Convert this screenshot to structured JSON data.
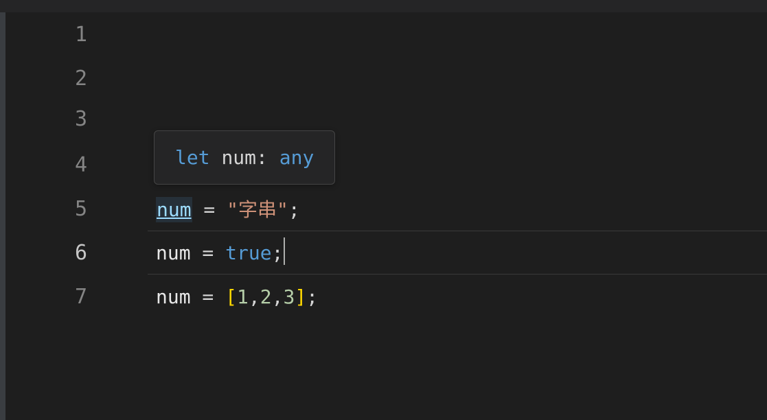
{
  "gutter": {
    "ln1": "1",
    "ln2": "2",
    "ln3": "3",
    "ln4": "4",
    "ln5": "5",
    "ln6": "6",
    "ln7": "7"
  },
  "tooltip": {
    "keyword": "let",
    "identifier": "num",
    "colon": ": ",
    "type": "any"
  },
  "line5": {
    "var": "num",
    "op": " = ",
    "str": "\"字串\"",
    "semi": ";"
  },
  "line6": {
    "var": "num",
    "op": " = ",
    "bool": "true",
    "semi": ";"
  },
  "line7": {
    "var": "num",
    "op": " = ",
    "lb": "[",
    "n1": "1",
    "c1": ",",
    "n2": "2",
    "c2": ",",
    "n3": "3",
    "rb": "]",
    "semi": ";"
  }
}
